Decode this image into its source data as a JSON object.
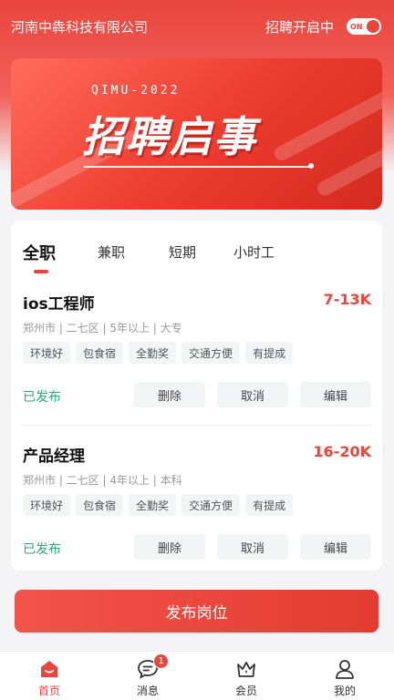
{
  "header": {
    "company": "河南中犇科技有限公司",
    "recruit_label": "招聘开启中",
    "toggle_text": "ON"
  },
  "banner": {
    "subtitle": "QIMU-2022",
    "title": "招聘启事"
  },
  "tabs": [
    {
      "label": "全职",
      "active": true
    },
    {
      "label": "兼职",
      "active": false
    },
    {
      "label": "短期",
      "active": false
    },
    {
      "label": "小时工",
      "active": false
    }
  ],
  "jobs": [
    {
      "title": "ios工程师",
      "salary": "7-13K",
      "meta": "郑州市 | 二七区 | 5年以上 | 大专",
      "tags": [
        "环境好",
        "包食宿",
        "全勤奖",
        "交通方便",
        "有提成"
      ],
      "status": "已发布",
      "actions": [
        "删除",
        "取消",
        "编辑"
      ]
    },
    {
      "title": "产品经理",
      "salary": "16-20K",
      "meta": "郑州市 | 二七区 | 4年以上 | 本科",
      "tags": [
        "环境好",
        "包食宿",
        "全勤奖",
        "交通方便",
        "有提成"
      ],
      "status": "已发布",
      "actions": [
        "删除",
        "取消",
        "编辑"
      ]
    }
  ],
  "publish_label": "发布岗位",
  "tabbar": [
    {
      "label": "首页",
      "icon": "home-icon",
      "active": true
    },
    {
      "label": "消息",
      "icon": "message-icon",
      "badge": "1"
    },
    {
      "label": "会员",
      "icon": "crown-icon"
    },
    {
      "label": "我的",
      "icon": "user-icon"
    }
  ],
  "colors": {
    "accent": "#e8463d",
    "status_green": "#2ba875"
  }
}
